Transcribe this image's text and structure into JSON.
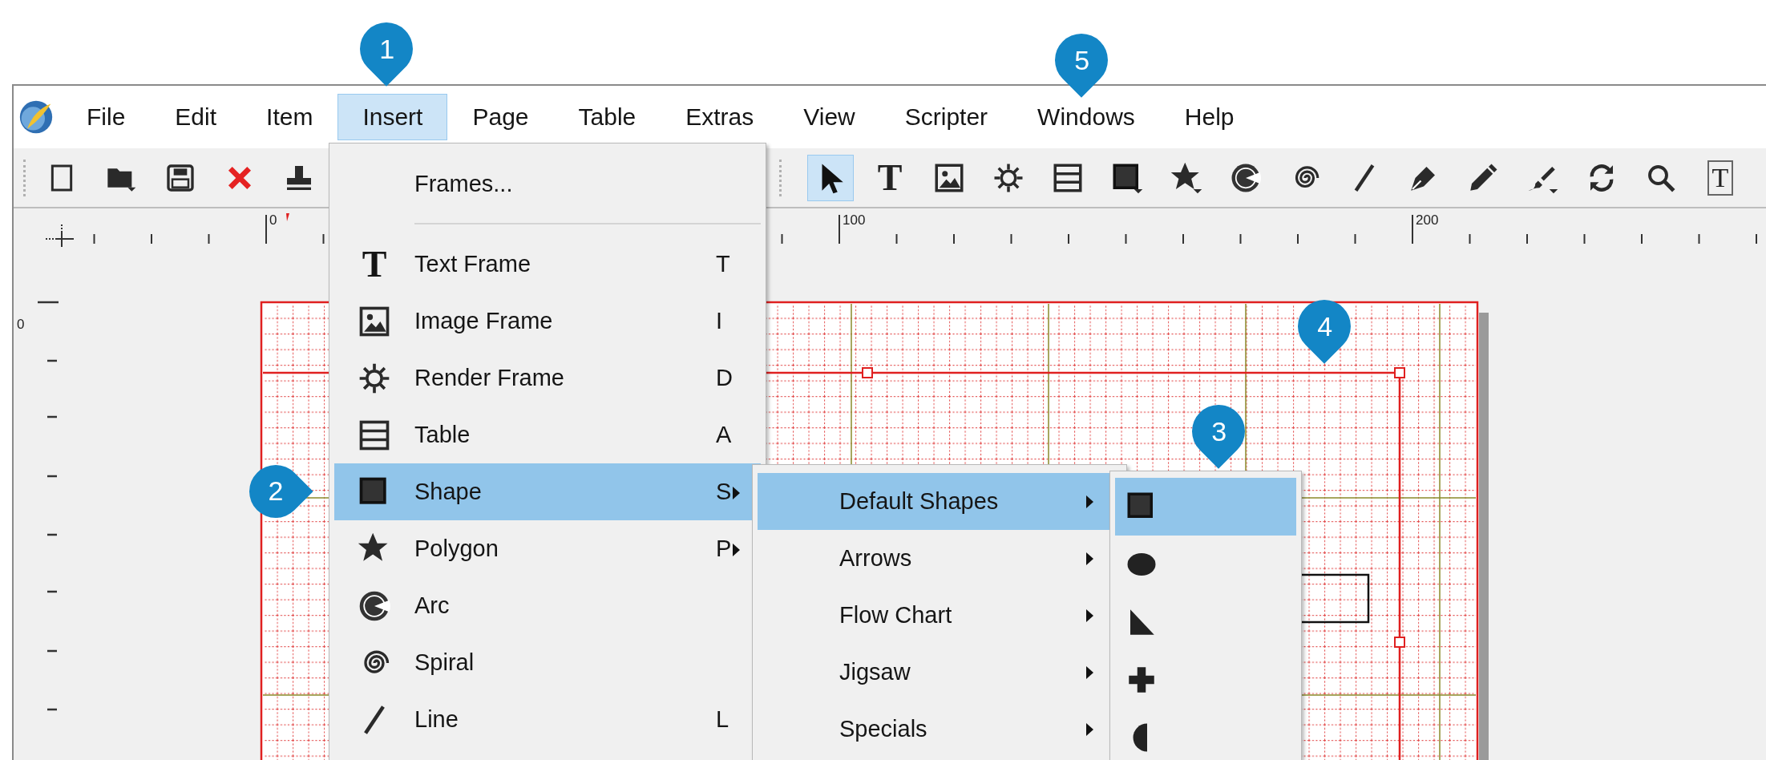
{
  "menu_bar": {
    "items": [
      {
        "label": "File",
        "selected": false
      },
      {
        "label": "Edit",
        "selected": false
      },
      {
        "label": "Item",
        "selected": false
      },
      {
        "label": "Insert",
        "selected": true
      },
      {
        "label": "Page",
        "selected": false
      },
      {
        "label": "Table",
        "selected": false
      },
      {
        "label": "Extras",
        "selected": false
      },
      {
        "label": "View",
        "selected": false
      },
      {
        "label": "Scripter",
        "selected": false
      },
      {
        "label": "Windows",
        "selected": false
      },
      {
        "label": "Help",
        "selected": false
      }
    ]
  },
  "toolbar": {
    "file_tools": [
      {
        "kind": "new"
      },
      {
        "kind": "open"
      },
      {
        "kind": "save"
      },
      {
        "kind": "close"
      },
      {
        "kind": "print"
      }
    ],
    "edit_tools": [
      {
        "kind": "select",
        "selected": true
      },
      {
        "kind": "text",
        "glyph": "T",
        "selected": false
      },
      {
        "kind": "image",
        "selected": false
      },
      {
        "kind": "render",
        "selected": false
      },
      {
        "kind": "table",
        "selected": false
      },
      {
        "kind": "shape",
        "selected": false
      },
      {
        "kind": "polygon",
        "selected": false
      },
      {
        "kind": "arc",
        "selected": false
      },
      {
        "kind": "spiral",
        "selected": false
      },
      {
        "kind": "line",
        "selected": false
      },
      {
        "kind": "bezier",
        "selected": false
      },
      {
        "kind": "freehand",
        "selected": false
      },
      {
        "kind": "calligraphic",
        "selected": false
      },
      {
        "kind": "rotate",
        "selected": false
      },
      {
        "kind": "zoom",
        "selected": false
      },
      {
        "kind": "text-edit",
        "glyph": "T",
        "selected": false
      }
    ]
  },
  "rulers": {
    "horizontal_labels": [
      "0",
      "100",
      "200"
    ],
    "vertical_labels": [
      "0"
    ]
  },
  "insert_menu": {
    "items": [
      {
        "kind": "plain",
        "label": "Frames...",
        "submenu": false,
        "selected": false
      },
      {
        "kind": "separator"
      },
      {
        "kind": "text",
        "glyph": "T",
        "label": "Text Frame",
        "shortcut": "T",
        "submenu": false,
        "selected": false
      },
      {
        "kind": "image",
        "label": "Image Frame",
        "shortcut": "I",
        "submenu": false,
        "selected": false
      },
      {
        "kind": "render",
        "label": "Render Frame",
        "shortcut": "D",
        "submenu": false,
        "selected": false
      },
      {
        "kind": "table",
        "label": "Table",
        "shortcut": "A",
        "submenu": false,
        "selected": false
      },
      {
        "kind": "shape",
        "label": "Shape",
        "shortcut": "S",
        "submenu": true,
        "selected": true
      },
      {
        "kind": "polygon",
        "label": "Polygon",
        "shortcut": "P",
        "submenu": true,
        "selected": false
      },
      {
        "kind": "arc",
        "label": "Arc",
        "submenu": false,
        "selected": false
      },
      {
        "kind": "spiral",
        "label": "Spiral",
        "submenu": false,
        "selected": false
      },
      {
        "kind": "line",
        "label": "Line",
        "shortcut": "L",
        "submenu": false,
        "selected": false
      }
    ]
  },
  "shape_submenu": {
    "items": [
      {
        "label": "Default Shapes",
        "submenu": true,
        "selected": true
      },
      {
        "label": "Arrows",
        "submenu": true,
        "selected": false
      },
      {
        "label": "Flow Chart",
        "submenu": true,
        "selected": false
      },
      {
        "label": "Jigsaw",
        "submenu": true,
        "selected": false
      },
      {
        "label": "Specials",
        "submenu": true,
        "selected": false
      }
    ]
  },
  "default_shapes_submenu": {
    "items": [
      {
        "kind": "square",
        "selected": true
      },
      {
        "kind": "ellipse",
        "selected": false
      },
      {
        "kind": "triangle",
        "selected": false
      },
      {
        "kind": "cross",
        "selected": false
      },
      {
        "kind": "half-circle",
        "selected": false
      }
    ]
  },
  "callouts": [
    {
      "label": "1"
    },
    {
      "label": "2"
    },
    {
      "label": "3"
    },
    {
      "label": "4"
    },
    {
      "label": "5"
    }
  ]
}
